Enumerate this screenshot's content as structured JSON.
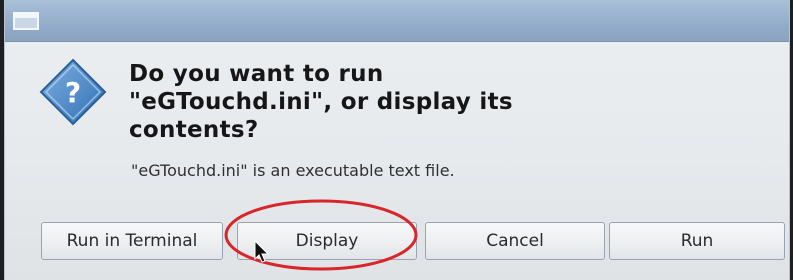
{
  "dialog": {
    "heading_lines": [
      "Do you want to run",
      "\"eGTouchd.ini\", or display its",
      "contents?"
    ],
    "subtext": "\"eGTouchd.ini\" is an executable text file.",
    "icon": "question-icon"
  },
  "buttons": {
    "run_in_terminal": "Run in Terminal",
    "display": "Display",
    "cancel": "Cancel",
    "run": "Run"
  },
  "colors": {
    "titlebar": "#93acc9",
    "dialog_bg": "#e6eaed",
    "icon_blue": "#4d86c4",
    "annotation_red": "#d8262b"
  }
}
